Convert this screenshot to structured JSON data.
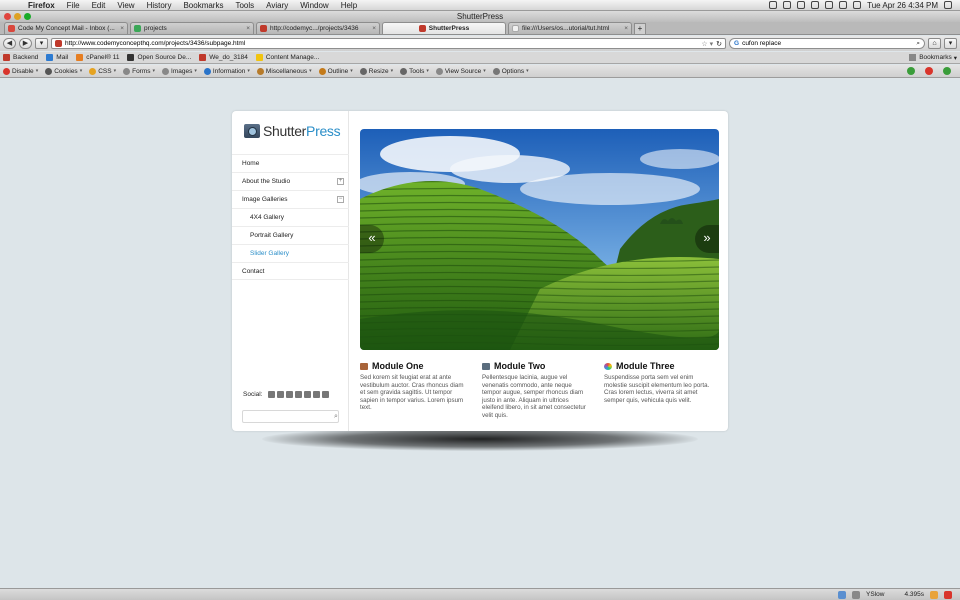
{
  "menubar": {
    "apple": "",
    "app": "Firefox",
    "items": [
      "File",
      "Edit",
      "View",
      "History",
      "Bookmarks",
      "Tools",
      "Aviary",
      "Window",
      "Help"
    ],
    "clock": "Tue Apr 26  4:34 PM"
  },
  "window": {
    "title": "ShutterPress"
  },
  "tabs": [
    {
      "label": "Code My Concept Mail - Inbox (...",
      "color": "#d9473d"
    },
    {
      "label": "projects",
      "color": "#3aa757"
    },
    {
      "label": "http://codemyc.../projects/3436",
      "color": "#c0392b"
    },
    {
      "label": "ShutterPress",
      "color": "#c0392b"
    },
    {
      "label": "file:///Users/os...utorial/tut.html",
      "color": "#f1f1f1"
    }
  ],
  "nav": {
    "back": "◀",
    "forward": "▶",
    "url": "http://www.codemyconcepthq.com/projects/3436/subpage.html",
    "search_value": "cufon replace",
    "home": "⌂"
  },
  "bookmarks": {
    "items": [
      {
        "label": "Backend",
        "color": "#c0392b"
      },
      {
        "label": "Mail",
        "color": "#2d7bd1"
      },
      {
        "label": "cPanel® 11",
        "color": "#e67e22"
      },
      {
        "label": "Open Source De...",
        "color": "#333"
      },
      {
        "label": "We_do_3184",
        "color": "#c0392b"
      },
      {
        "label": "Content Manage...",
        "color": "#f1c40f"
      }
    ],
    "right": "Bookmarks"
  },
  "devbar": {
    "items": [
      {
        "label": "Disable",
        "color": "#d9342b"
      },
      {
        "label": "Cookies",
        "color": "#555"
      },
      {
        "label": "CSS",
        "color": "#e5a321"
      },
      {
        "label": "Forms",
        "color": "#888"
      },
      {
        "label": "Images",
        "color": "#888"
      },
      {
        "label": "Information",
        "color": "#2a74c9"
      },
      {
        "label": "Miscellaneous",
        "color": "#b77b2a"
      },
      {
        "label": "Outline",
        "color": "#c47a19"
      },
      {
        "label": "Resize",
        "color": "#666"
      },
      {
        "label": "Tools",
        "color": "#666"
      },
      {
        "label": "View Source",
        "color": "#888"
      },
      {
        "label": "Options",
        "color": "#777"
      }
    ]
  },
  "site": {
    "logo_part1": "Shutter",
    "logo_part2": "Press",
    "menu": [
      {
        "label": "Home",
        "sub": false,
        "active": false,
        "toggle": ""
      },
      {
        "label": "About the Studio",
        "sub": false,
        "active": false,
        "toggle": "+"
      },
      {
        "label": "Image Galleries",
        "sub": false,
        "active": false,
        "toggle": "−"
      },
      {
        "label": "4X4 Gallery",
        "sub": true,
        "active": false,
        "toggle": ""
      },
      {
        "label": "Portrait Gallery",
        "sub": true,
        "active": false,
        "toggle": ""
      },
      {
        "label": "Slider Gallery",
        "sub": true,
        "active": true,
        "toggle": ""
      },
      {
        "label": "Contact",
        "sub": false,
        "active": false,
        "toggle": ""
      }
    ],
    "social_label": "Social:",
    "slider_prev": "«",
    "slider_next": "»",
    "modules": [
      {
        "title": "Module One",
        "icon_color": "#a8643a",
        "text": "Sed korem sit feugiat erat at ante vestibulum auctor. Cras rhoncus diam et sem gravida sagittis. Ut tempor sapien in tempor varius. Lorem ipsum text."
      },
      {
        "title": "Module Two",
        "icon_color": "#5b6d7e",
        "text": "Pellentesque lacinia, augue vel venenatis commodo, ante neque tempor augue, semper rhoncus diam justo in ante. Aliquam in ultrices eleifend libero, in sit amet consectetur velit quis."
      },
      {
        "title": "Module Three",
        "icon_color": "#e74c3c",
        "text": "Suspendisse porta sem vel enim molestie suscipit elementum leo porta. Cras lorem lectus, viverra sit amet semper quis, vehicula quis velit."
      }
    ]
  },
  "statusbar": {
    "yslow": "YSlow",
    "time": "4.395s"
  }
}
